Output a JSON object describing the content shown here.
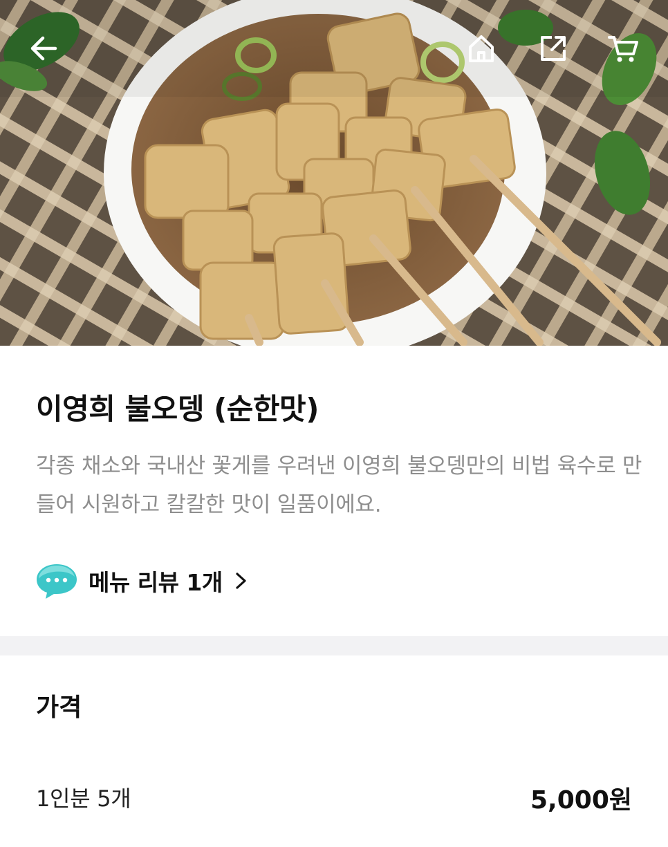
{
  "header": {
    "back_icon": "arrow-left-icon",
    "home_icon": "home-icon",
    "share_icon": "share-icon",
    "cart_icon": "cart-icon"
  },
  "product": {
    "name": "이영희 불오뎅 (순한맛)",
    "description": "각종 채소와 국내산 꽃게를 우려낸 이영희 불오뎅만의 비법 육수로 만들어 시원하고 칼칼한 맛이 일품이에요.",
    "review_link": "메뉴 리뷰 1개",
    "review_icon": "speech-bubble-icon"
  },
  "price": {
    "heading": "가격",
    "options": [
      {
        "label": "1인분 5개",
        "amount": "5,000원"
      }
    ]
  },
  "colors": {
    "accent_bubble": "#3cc6c8",
    "desc_text": "#8e8e8e",
    "divider": "#f2f2f4"
  }
}
